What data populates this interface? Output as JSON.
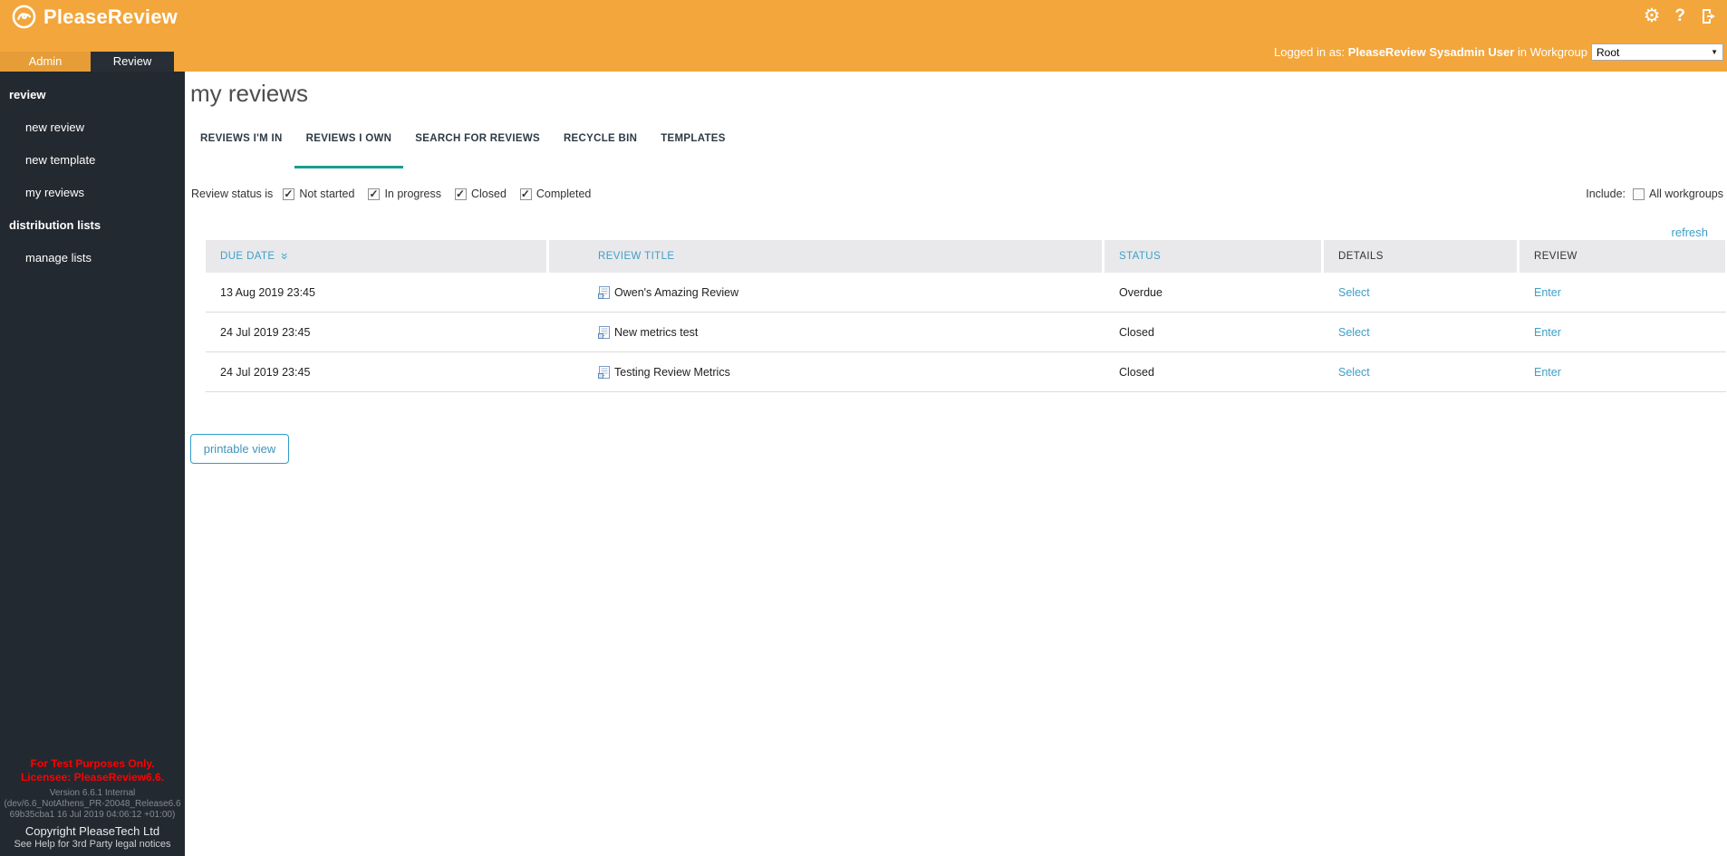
{
  "colors": {
    "accent_orange": "#F3A63B",
    "accent_teal": "#199E8E",
    "link_blue": "#3E9FC7",
    "license_red": "#FF0000"
  },
  "header": {
    "brand": "PleaseReview",
    "module_tabs": [
      "Admin",
      "Review"
    ],
    "logged_in_prefix": "Logged in as:",
    "user_name": "PleaseReview Sysadmin User",
    "logged_in_suffix": "in Workgroup",
    "workgroup_value": "Root"
  },
  "sidebar": {
    "sections": [
      {
        "heading": "review",
        "items": [
          "new review",
          "new template",
          "my reviews"
        ]
      },
      {
        "heading": "distribution lists",
        "items": [
          "manage lists"
        ]
      }
    ],
    "license_notice": [
      "For Test Purposes Only.",
      "Licensee: PleaseReview6.6."
    ],
    "version_lines": [
      "Version 6.6.1 Internal",
      "(dev/6.6_NotAthens_PR-20048_Release6.6",
      "69b35cba1 16 Jul 2019 04:06:12 +01:00)"
    ],
    "copyright": "Copyright PleaseTech Ltd",
    "legal": "See Help for 3rd Party legal notices"
  },
  "main": {
    "title": "my reviews",
    "tabs": [
      {
        "label": "REVIEWS I'M IN",
        "active": false
      },
      {
        "label": "REVIEWS I OWN",
        "active": true
      },
      {
        "label": "SEARCH FOR REVIEWS",
        "active": false
      },
      {
        "label": "RECYCLE BIN",
        "active": false
      },
      {
        "label": "TEMPLATES",
        "active": false
      }
    ],
    "filters": {
      "label": "Review status is",
      "options": [
        {
          "label": "Not started",
          "checked": true
        },
        {
          "label": "In progress",
          "checked": true
        },
        {
          "label": "Closed",
          "checked": true
        },
        {
          "label": "Completed",
          "checked": true
        }
      ]
    },
    "include": {
      "label": "Include:",
      "option": "All workgroups",
      "checked": false
    },
    "refresh_label": "refresh",
    "table": {
      "columns": [
        {
          "label": "DUE DATE",
          "sortable": true
        },
        {
          "label": "REVIEW TITLE"
        },
        {
          "label": "STATUS"
        },
        {
          "label": "DETAILS"
        },
        {
          "label": "REVIEW"
        }
      ],
      "rows": [
        {
          "due": "13 Aug 2019 23:45",
          "title": "Owen's Amazing Review",
          "status": "Overdue",
          "details": "Select",
          "review": "Enter"
        },
        {
          "due": "24 Jul 2019 23:45",
          "title": "New metrics test",
          "status": "Closed",
          "details": "Select",
          "review": "Enter"
        },
        {
          "due": "24 Jul 2019 23:45",
          "title": "Testing Review Metrics",
          "status": "Closed",
          "details": "Select",
          "review": "Enter"
        }
      ]
    },
    "printable_button": "printable view"
  }
}
